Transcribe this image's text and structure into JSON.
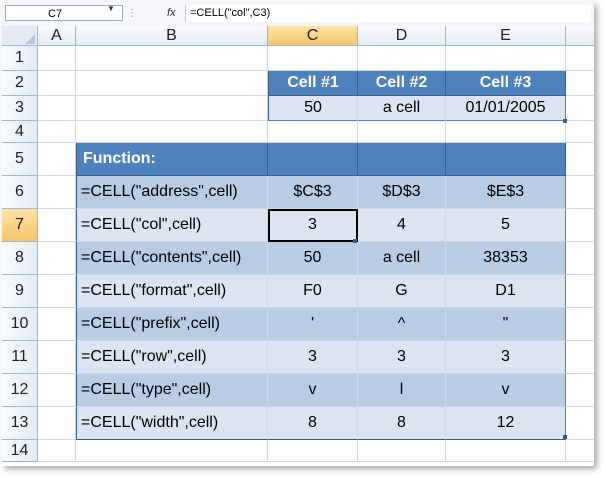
{
  "formula_bar": {
    "name_box": "C7",
    "formula": "=CELL(\"col\",C3)"
  },
  "columns": [
    "A",
    "B",
    "C",
    "D",
    "E"
  ],
  "rows": [
    "1",
    "2",
    "3",
    "4",
    "5",
    "6",
    "7",
    "8",
    "9",
    "10",
    "11",
    "12",
    "13",
    "14"
  ],
  "table": {
    "header_labels": [
      "Cell #1",
      "Cell #2",
      "Cell #3"
    ],
    "values": [
      "50",
      "a cell",
      "01/01/2005"
    ],
    "function_header": "Function:",
    "functions": [
      {
        "formula": "=CELL(\"address\",cell)",
        "c": "$C$3",
        "d": "$D$3",
        "e": "$E$3"
      },
      {
        "formula": "=CELL(\"col\",cell)",
        "c": "3",
        "d": "4",
        "e": "5"
      },
      {
        "formula": "=CELL(\"contents\",cell)",
        "c": "50",
        "d": "a cell",
        "e": "38353"
      },
      {
        "formula": "=CELL(\"format\",cell)",
        "c": "F0",
        "d": "G",
        "e": "D1"
      },
      {
        "formula": "=CELL(\"prefix\",cell)",
        "c": "'",
        "d": "^",
        "e": "\""
      },
      {
        "formula": "=CELL(\"row\",cell)",
        "c": "3",
        "d": "3",
        "e": "3"
      },
      {
        "formula": "=CELL(\"type\",cell)",
        "c": "v",
        "d": "l",
        "e": "v"
      },
      {
        "formula": "=CELL(\"width\",cell)",
        "c": "8",
        "d": "8",
        "e": "12"
      }
    ]
  },
  "colors": {
    "header_blue": "#4f81bd",
    "band_dark": "#b8cce4",
    "band_light": "#dbe5f1"
  }
}
